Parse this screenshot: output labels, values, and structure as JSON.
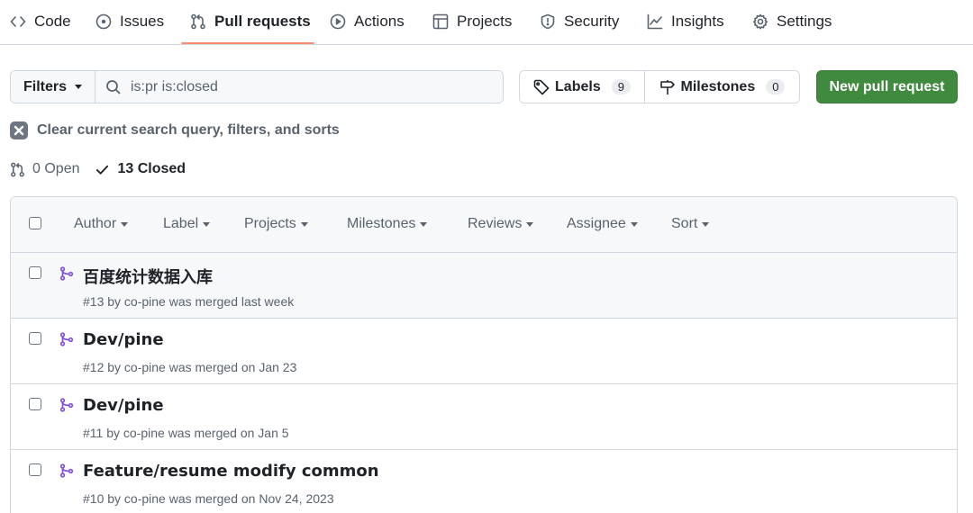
{
  "nav": {
    "tabs": [
      {
        "label": "Code",
        "icon": "code-icon"
      },
      {
        "label": "Issues",
        "icon": "issue-opened-icon"
      },
      {
        "label": "Pull requests",
        "icon": "git-pull-request-icon",
        "active": true
      },
      {
        "label": "Actions",
        "icon": "play-icon"
      },
      {
        "label": "Projects",
        "icon": "table-icon"
      },
      {
        "label": "Security",
        "icon": "shield-icon"
      },
      {
        "label": "Insights",
        "icon": "graph-icon"
      },
      {
        "label": "Settings",
        "icon": "gear-icon"
      }
    ],
    "active_underline_color": "#fd8c73"
  },
  "toolbar": {
    "filters_label": "Filters",
    "search_value": "is:pr is:closed",
    "labels_label": "Labels",
    "labels_count": "9",
    "milestones_label": "Milestones",
    "milestones_count": "0",
    "new_pr_label": "New pull request",
    "new_pr_color": "#3f8a3f"
  },
  "clear_query_label": "Clear current search query, filters, and sorts",
  "states": {
    "open_label": "0 Open",
    "closed_label": "13 Closed"
  },
  "list_header": {
    "filters": [
      "Author",
      "Label",
      "Projects",
      "Milestones",
      "Reviews",
      "Assignee",
      "Sort"
    ]
  },
  "pull_requests": [
    {
      "title": "百度统计数据入库",
      "meta": "#13 by co-pine was merged last week"
    },
    {
      "title": "Dev/pine",
      "meta": "#12 by co-pine was merged on Jan 23"
    },
    {
      "title": "Dev/pine",
      "meta": "#11 by co-pine was merged on Jan 5"
    },
    {
      "title": "Feature/resume modify common",
      "meta": "#10 by co-pine was merged on Nov 24, 2023"
    }
  ],
  "colors": {
    "merged_icon": "#8250df",
    "border": "#d0d7de",
    "muted_text": "#59636e"
  }
}
